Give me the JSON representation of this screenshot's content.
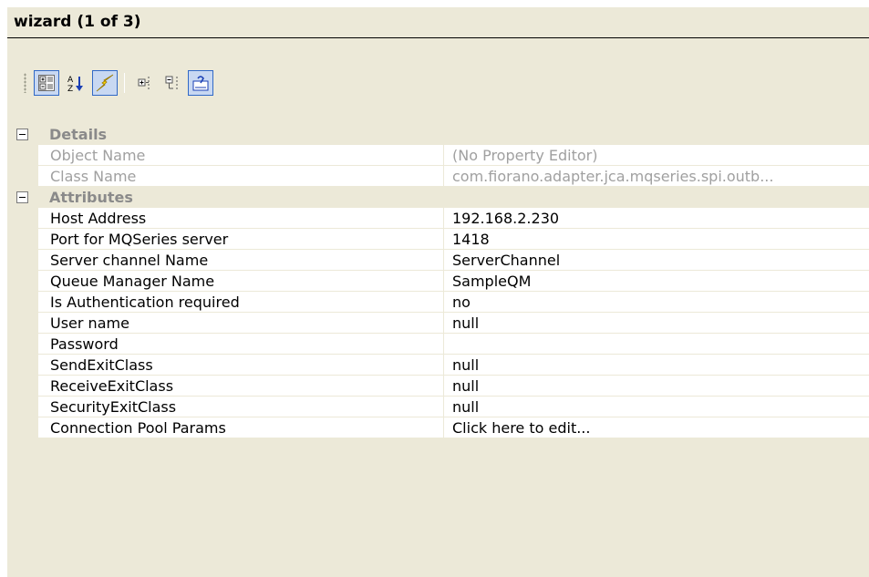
{
  "window": {
    "title": "wizard (1 of 3)"
  },
  "toolbar": {
    "buttons": [
      {
        "icon": "categorized-icon",
        "pressed": true
      },
      {
        "icon": "alphabetical-sort-icon",
        "pressed": false
      },
      {
        "icon": "events-lightning-icon",
        "pressed": true
      },
      {
        "icon": "expand-all-icon",
        "pressed": false
      },
      {
        "icon": "collapse-all-icon",
        "pressed": false
      },
      {
        "icon": "property-pages-icon",
        "pressed": true
      }
    ]
  },
  "categories": [
    {
      "label": "Details",
      "expand_icon": "collapse-minus-icon",
      "properties": [
        {
          "name": "Object Name",
          "value": "(No Property Editor)",
          "disabled": true
        },
        {
          "name": "Class Name",
          "value": "com.fiorano.adapter.jca.mqseries.spi.outb...",
          "disabled": true
        }
      ]
    },
    {
      "label": "Attributes",
      "expand_icon": "collapse-minus-icon",
      "properties": [
        {
          "name": "Host Address",
          "value": "192.168.2.230"
        },
        {
          "name": "Port for MQSeries server",
          "value": "1418"
        },
        {
          "name": "Server channel Name",
          "value": "ServerChannel"
        },
        {
          "name": "Queue Manager Name",
          "value": "SampleQM"
        },
        {
          "name": "Is Authentication required",
          "value": "no"
        },
        {
          "name": "User name",
          "value": "null"
        },
        {
          "name": "Password",
          "value": ""
        },
        {
          "name": "SendExitClass",
          "value": "null"
        },
        {
          "name": "ReceiveExitClass",
          "value": "null"
        },
        {
          "name": "SecurityExitClass",
          "value": "null"
        },
        {
          "name": "Connection Pool Params",
          "value": "Click here to edit..."
        }
      ]
    }
  ],
  "colors": {
    "panel_bg": "#ece9d8",
    "pressed_bg": "#c8d8f2",
    "pressed_border": "#3169c6",
    "disabled_text": "#a0a0a0"
  }
}
